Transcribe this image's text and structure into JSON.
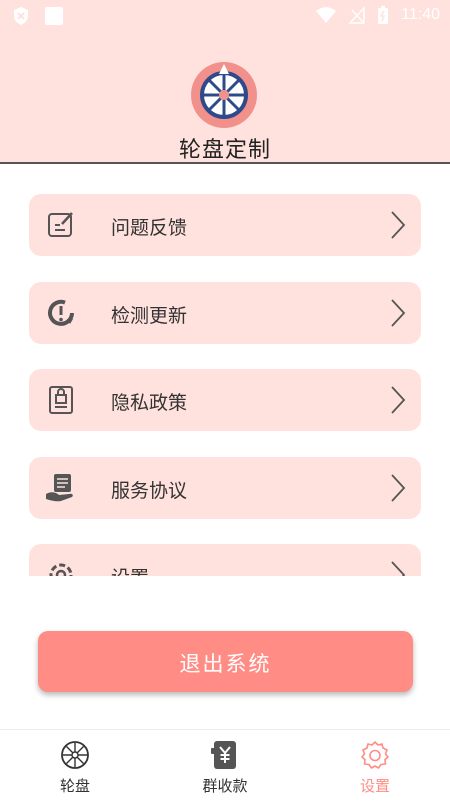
{
  "status_bar": {
    "time": "11:40"
  },
  "header": {
    "title": "轮盘定制"
  },
  "menu": {
    "items": [
      {
        "label": "问题反馈",
        "icon": "feedback-icon"
      },
      {
        "label": "检测更新",
        "icon": "update-icon"
      },
      {
        "label": "隐私政策",
        "icon": "privacy-icon"
      },
      {
        "label": "服务协议",
        "icon": "agreement-icon"
      },
      {
        "label": "设置",
        "icon": "settings-icon"
      }
    ]
  },
  "logout_button": {
    "label": "退出系统"
  },
  "bottom_nav": {
    "tabs": [
      {
        "label": "轮盘",
        "icon": "wheel-icon"
      },
      {
        "label": "群收款",
        "icon": "yuan-icon"
      },
      {
        "label": "设置",
        "icon": "gear-icon",
        "active": true
      }
    ]
  },
  "colors": {
    "accent": "#ff8d86",
    "header_bg": "#ffe1dd",
    "item_bg": "#ffe1dd"
  }
}
